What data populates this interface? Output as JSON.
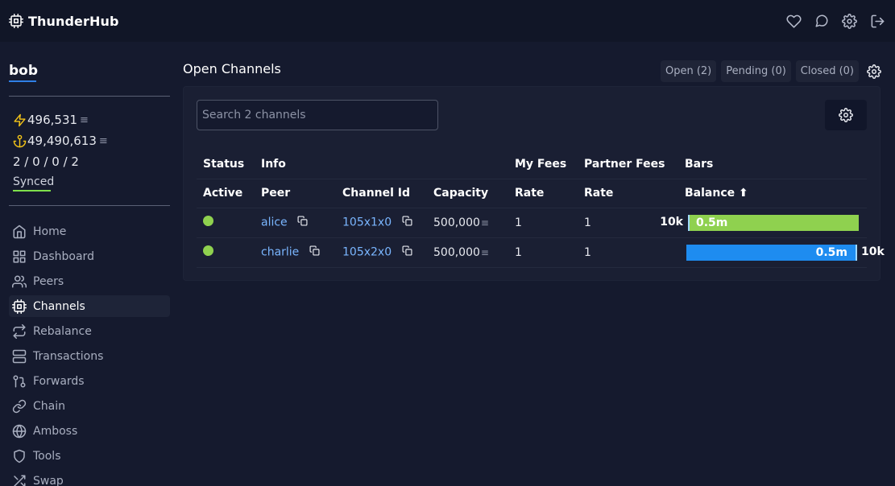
{
  "app": {
    "brand": "ThunderHub",
    "header_icons": [
      "heart-icon",
      "chat-icon",
      "gear-icon",
      "logout-icon"
    ]
  },
  "sidebar": {
    "user": "bob",
    "lightning_balance": "496,531",
    "chain_balance": "49,490,613",
    "sats_symbol": "≡",
    "peer_counts": "2 / 0 / 0 / 2",
    "sync_status": "Synced",
    "nav": [
      {
        "label": "Home",
        "icon": "home-icon"
      },
      {
        "label": "Dashboard",
        "icon": "grid-icon"
      },
      {
        "label": "Peers",
        "icon": "users-icon"
      },
      {
        "label": "Channels",
        "icon": "cpu-icon",
        "active": true
      },
      {
        "label": "Rebalance",
        "icon": "repeat-icon"
      },
      {
        "label": "Transactions",
        "icon": "server-icon"
      },
      {
        "label": "Forwards",
        "icon": "git-pull-request-icon"
      },
      {
        "label": "Chain",
        "icon": "link-icon"
      },
      {
        "label": "Amboss",
        "icon": "globe-icon"
      },
      {
        "label": "Tools",
        "icon": "shield-icon"
      },
      {
        "label": "Swap",
        "icon": "shuffle-icon"
      }
    ]
  },
  "main": {
    "title": "Open Channels",
    "filters": [
      {
        "label": "Open (2)"
      },
      {
        "label": "Pending (0)"
      },
      {
        "label": "Closed (0)"
      }
    ],
    "search_placeholder": "Search 2 channels",
    "table": {
      "group_headers": {
        "status": "Status",
        "info": "Info",
        "my_fees": "My Fees",
        "partner_fees": "Partner Fees",
        "bars": "Bars"
      },
      "column_headers": {
        "active": "Active",
        "peer": "Peer",
        "channel_id": "Channel Id",
        "capacity": "Capacity",
        "my_rate": "Rate",
        "partner_rate": "Rate",
        "balance": "Balance ⬆"
      },
      "rows": [
        {
          "peer": "alice",
          "channel_id": "105x1x0",
          "capacity": "500,000",
          "my_rate": "1",
          "partner_rate": "1",
          "local_label": "10k",
          "remote_label": "0.5m",
          "local_fraction": 0.02,
          "remote_color": "#8fd14f"
        },
        {
          "peer": "charlie",
          "channel_id": "105x2x0",
          "capacity": "500,000",
          "my_rate": "1",
          "partner_rate": "1",
          "local_label": "0.5m",
          "remote_label": "10k",
          "local_fraction": 0.98,
          "local_color": "#1e8cf0"
        }
      ]
    }
  }
}
